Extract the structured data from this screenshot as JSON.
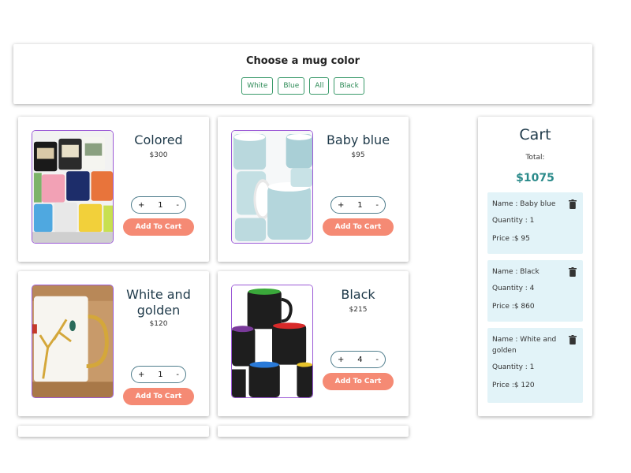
{
  "filter": {
    "title": "Choose a mug color",
    "buttons": [
      "White",
      "Blue",
      "All",
      "Black"
    ]
  },
  "qty_controls": {
    "minus": "-",
    "plus": "+"
  },
  "products": [
    {
      "name": "Colored",
      "price": "$300",
      "qty": "1",
      "button": "Add To Cart",
      "image": "colored-mugs-image"
    },
    {
      "name": "Baby blue",
      "price": "$95",
      "qty": "1",
      "button": "Add To Cart",
      "image": "baby-blue-mugs-image"
    },
    {
      "name": "White and golden",
      "price": "$120",
      "qty": "1",
      "button": "Add To Cart",
      "image": "white-golden-mug-image"
    },
    {
      "name": "Black",
      "price": "$215",
      "qty": "4",
      "button": "Add To Cart",
      "image": "black-mugs-image"
    }
  ],
  "cart": {
    "title": "Cart",
    "total_label": "Total:",
    "total": "$1075",
    "items": [
      {
        "name": "Name : Baby blue",
        "qty": "Quantity : 1",
        "price": "Price :$ 95"
      },
      {
        "name": "Name : Black",
        "qty": "Quantity : 4",
        "price": "Price :$ 860"
      },
      {
        "name": "Name : White and golden",
        "qty": "Quantity : 1",
        "price": "Price :$ 120"
      }
    ]
  },
  "colors": {
    "accent_green": "#2e8b57",
    "add_button": "#f58a74",
    "image_border": "#9b59d6",
    "cart_item_bg": "#e2f3f8",
    "total_color": "#2a8a8a"
  }
}
